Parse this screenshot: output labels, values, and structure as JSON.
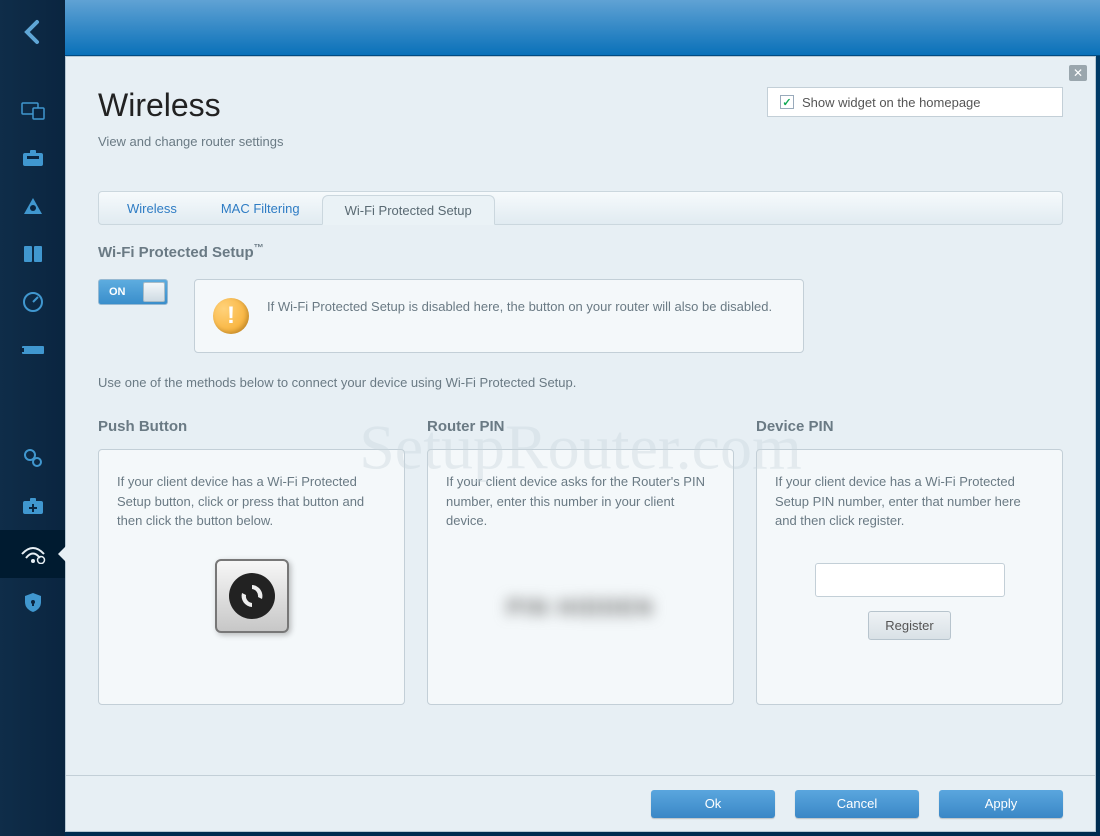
{
  "header": {
    "title": "Wireless",
    "subtitle": "View and change router settings",
    "widget_checkbox_label": "Show widget on the homepage",
    "widget_checked": true
  },
  "tabs": [
    {
      "label": "Wireless",
      "active": false
    },
    {
      "label": "MAC Filtering",
      "active": false
    },
    {
      "label": "Wi-Fi Protected Setup",
      "active": true
    }
  ],
  "section": {
    "title_prefix": "Wi-Fi Protected Setup",
    "title_suffix": "™",
    "toggle_label": "ON",
    "info_text": "If Wi-Fi Protected Setup is disabled here, the button on your router will also be disabled.",
    "instruction": "Use one of the methods below to connect your device using Wi-Fi Protected Setup."
  },
  "columns": {
    "push": {
      "title": "Push Button",
      "text": "If your client device has a Wi-Fi Protected Setup button, click or press that button and then click the button below."
    },
    "router_pin": {
      "title": "Router PIN",
      "text": "If your client device asks for the Router's PIN number, enter this number in your client device.",
      "value_obscured": "PIN HIDDEN"
    },
    "device_pin": {
      "title": "Device PIN",
      "text": "If your client device has a Wi-Fi Protected Setup PIN number, enter that number here and then click register.",
      "input_value": "",
      "register_label": "Register"
    }
  },
  "footer": {
    "ok": "Ok",
    "cancel": "Cancel",
    "apply": "Apply"
  },
  "watermark": "SetupRouter.com",
  "sidebar_icons": [
    "devices-icon",
    "suitcase-icon",
    "triangle-icon",
    "media-icon",
    "gauge-icon",
    "usb-icon",
    "gears-icon",
    "first-aid-icon",
    "wifi-settings-icon",
    "security-shield-icon"
  ]
}
